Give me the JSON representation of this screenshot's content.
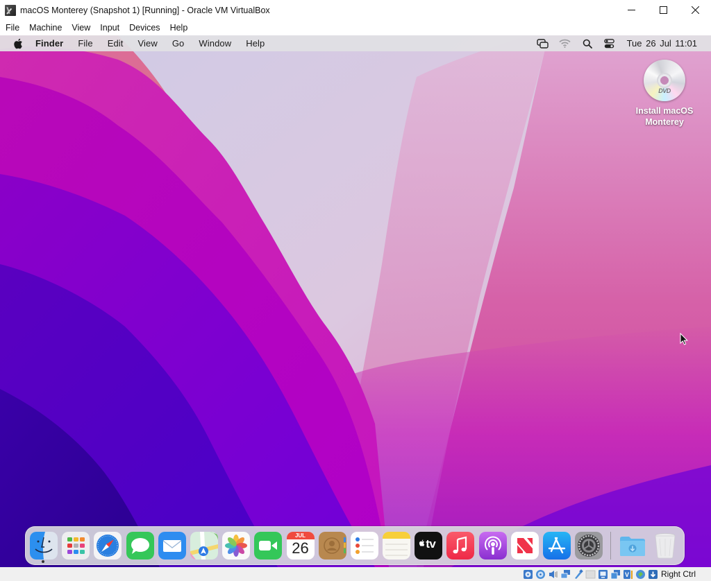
{
  "window": {
    "title": "macOS Monterey (Snapshot 1) [Running] - Oracle VM VirtualBox",
    "controls": [
      "minimize",
      "maximize",
      "close"
    ]
  },
  "vbox_menu": {
    "items": [
      {
        "label": "File"
      },
      {
        "label": "Machine"
      },
      {
        "label": "View"
      },
      {
        "label": "Input"
      },
      {
        "label": "Devices"
      },
      {
        "label": "Help"
      }
    ]
  },
  "mac_menubar": {
    "apple_icon": "apple-icon",
    "app_name": "Finder",
    "items": [
      {
        "label": "File"
      },
      {
        "label": "Edit"
      },
      {
        "label": "View"
      },
      {
        "label": "Go"
      },
      {
        "label": "Window"
      },
      {
        "label": "Help"
      }
    ],
    "status_icons": [
      "screen-mirroring-icon",
      "wifi-icon",
      "spotlight-search-icon",
      "control-center-icon"
    ],
    "clock": "Tue 26 Jul  11:01"
  },
  "desktop": {
    "icons": [
      {
        "label_line1": "Install macOS",
        "label_line2": "Monterey",
        "icon": "dvd-icon",
        "disc_text": "DVD"
      }
    ]
  },
  "dock": {
    "apps": [
      {
        "name": "Finder",
        "running": true
      },
      {
        "name": "Launchpad"
      },
      {
        "name": "Safari"
      },
      {
        "name": "Messages"
      },
      {
        "name": "Mail"
      },
      {
        "name": "Maps"
      },
      {
        "name": "Photos"
      },
      {
        "name": "FaceTime"
      },
      {
        "name": "Calendar",
        "month": "JUL",
        "day": "26"
      },
      {
        "name": "Contacts"
      },
      {
        "name": "Reminders"
      },
      {
        "name": "Notes"
      },
      {
        "name": "TV",
        "text": "tv"
      },
      {
        "name": "Music"
      },
      {
        "name": "Podcasts"
      },
      {
        "name": "News"
      },
      {
        "name": "App Store"
      },
      {
        "name": "System Preferences"
      }
    ],
    "stacks": [
      {
        "name": "Downloads"
      },
      {
        "name": "Trash"
      }
    ]
  },
  "vbox_statusbar": {
    "icons": [
      "hard-disk-icon",
      "optical-drive-icon",
      "audio-icon",
      "network-icon",
      "usb-icon",
      "shared-folders-icon",
      "display-icon",
      "video-capture-icon",
      "virtualization-icon",
      "mouse-integration-icon",
      "keyboard-capture-icon"
    ],
    "host_key": "Right Ctrl"
  },
  "colors": {
    "wallpaper_light": "#d8d2e6",
    "wallpaper_pink": "#d65aa6",
    "wallpaper_magenta": "#c208c2",
    "wallpaper_violet": "#6a00c8",
    "wallpaper_deep": "#2e0090"
  }
}
